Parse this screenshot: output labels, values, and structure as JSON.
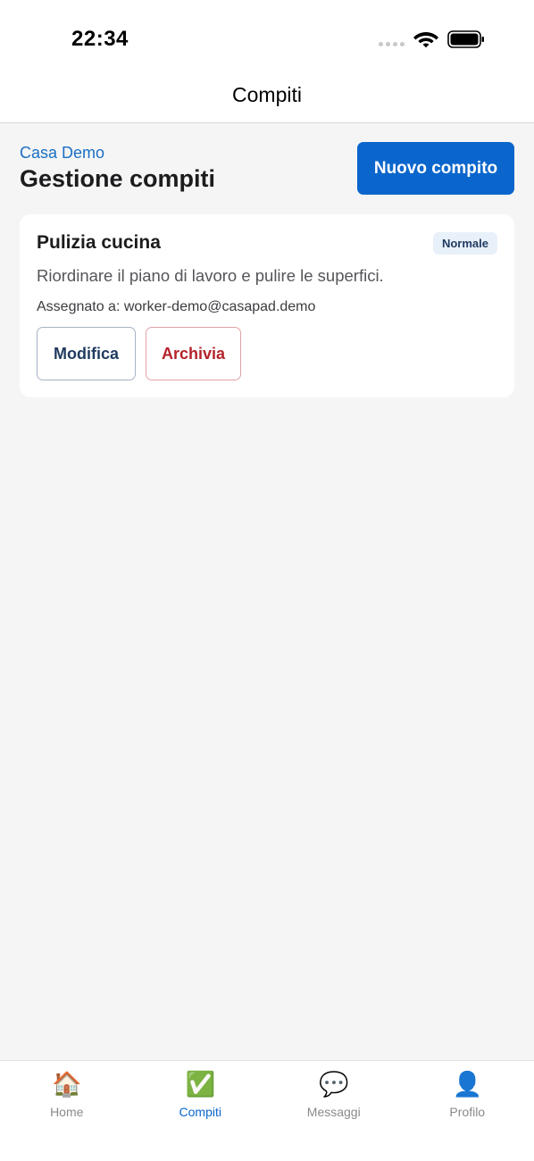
{
  "status_bar": {
    "time": "22:34",
    "icons": [
      "signal-dots-icon",
      "wifi-icon",
      "battery-icon"
    ]
  },
  "nav": {
    "title": "Compiti"
  },
  "header": {
    "house_name": "Casa Demo",
    "title": "Gestione compiti",
    "new_task_label": "Nuovo compito"
  },
  "tasks": [
    {
      "title": "Pulizia cucina",
      "priority": "Normale",
      "description": "Riordinare il piano di lavoro e pulire le superfici.",
      "assignee": "Assegnato a: worker-demo@casapad.demo",
      "edit_label": "Modifica",
      "archive_label": "Archivia"
    }
  ],
  "tab_bar": {
    "items": [
      {
        "label": "Home",
        "icon": "🏠",
        "icon_name": "house-icon",
        "active": false
      },
      {
        "label": "Compiti",
        "icon": "✅",
        "icon_name": "check-mark-icon",
        "active": true
      },
      {
        "label": "Messaggi",
        "icon": "💬",
        "icon_name": "speech-bubble-icon",
        "active": false
      },
      {
        "label": "Profilo",
        "icon": "👤",
        "icon_name": "user-silhouette-icon",
        "active": false
      }
    ]
  },
  "colors": {
    "accent": "#0a66cc",
    "danger": "#b4222b",
    "background": "#f5f5f6"
  }
}
